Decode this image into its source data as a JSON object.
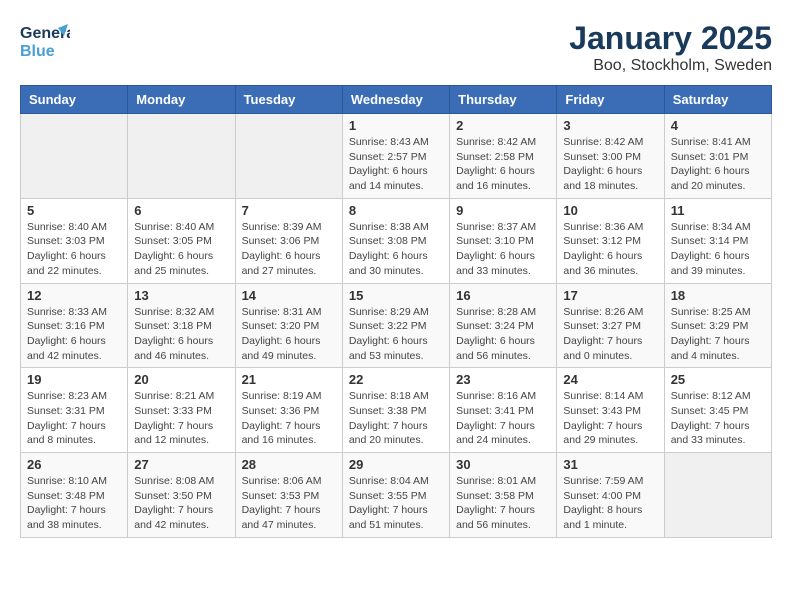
{
  "logo": {
    "line1": "General",
    "line2": "Blue"
  },
  "title": "January 2025",
  "subtitle": "Boo, Stockholm, Sweden",
  "days_of_week": [
    "Sunday",
    "Monday",
    "Tuesday",
    "Wednesday",
    "Thursday",
    "Friday",
    "Saturday"
  ],
  "weeks": [
    [
      {
        "day": "",
        "info": ""
      },
      {
        "day": "",
        "info": ""
      },
      {
        "day": "",
        "info": ""
      },
      {
        "day": "1",
        "info": "Sunrise: 8:43 AM\nSunset: 2:57 PM\nDaylight: 6 hours\nand 14 minutes."
      },
      {
        "day": "2",
        "info": "Sunrise: 8:42 AM\nSunset: 2:58 PM\nDaylight: 6 hours\nand 16 minutes."
      },
      {
        "day": "3",
        "info": "Sunrise: 8:42 AM\nSunset: 3:00 PM\nDaylight: 6 hours\nand 18 minutes."
      },
      {
        "day": "4",
        "info": "Sunrise: 8:41 AM\nSunset: 3:01 PM\nDaylight: 6 hours\nand 20 minutes."
      }
    ],
    [
      {
        "day": "5",
        "info": "Sunrise: 8:40 AM\nSunset: 3:03 PM\nDaylight: 6 hours\nand 22 minutes."
      },
      {
        "day": "6",
        "info": "Sunrise: 8:40 AM\nSunset: 3:05 PM\nDaylight: 6 hours\nand 25 minutes."
      },
      {
        "day": "7",
        "info": "Sunrise: 8:39 AM\nSunset: 3:06 PM\nDaylight: 6 hours\nand 27 minutes."
      },
      {
        "day": "8",
        "info": "Sunrise: 8:38 AM\nSunset: 3:08 PM\nDaylight: 6 hours\nand 30 minutes."
      },
      {
        "day": "9",
        "info": "Sunrise: 8:37 AM\nSunset: 3:10 PM\nDaylight: 6 hours\nand 33 minutes."
      },
      {
        "day": "10",
        "info": "Sunrise: 8:36 AM\nSunset: 3:12 PM\nDaylight: 6 hours\nand 36 minutes."
      },
      {
        "day": "11",
        "info": "Sunrise: 8:34 AM\nSunset: 3:14 PM\nDaylight: 6 hours\nand 39 minutes."
      }
    ],
    [
      {
        "day": "12",
        "info": "Sunrise: 8:33 AM\nSunset: 3:16 PM\nDaylight: 6 hours\nand 42 minutes."
      },
      {
        "day": "13",
        "info": "Sunrise: 8:32 AM\nSunset: 3:18 PM\nDaylight: 6 hours\nand 46 minutes."
      },
      {
        "day": "14",
        "info": "Sunrise: 8:31 AM\nSunset: 3:20 PM\nDaylight: 6 hours\nand 49 minutes."
      },
      {
        "day": "15",
        "info": "Sunrise: 8:29 AM\nSunset: 3:22 PM\nDaylight: 6 hours\nand 53 minutes."
      },
      {
        "day": "16",
        "info": "Sunrise: 8:28 AM\nSunset: 3:24 PM\nDaylight: 6 hours\nand 56 minutes."
      },
      {
        "day": "17",
        "info": "Sunrise: 8:26 AM\nSunset: 3:27 PM\nDaylight: 7 hours\nand 0 minutes."
      },
      {
        "day": "18",
        "info": "Sunrise: 8:25 AM\nSunset: 3:29 PM\nDaylight: 7 hours\nand 4 minutes."
      }
    ],
    [
      {
        "day": "19",
        "info": "Sunrise: 8:23 AM\nSunset: 3:31 PM\nDaylight: 7 hours\nand 8 minutes."
      },
      {
        "day": "20",
        "info": "Sunrise: 8:21 AM\nSunset: 3:33 PM\nDaylight: 7 hours\nand 12 minutes."
      },
      {
        "day": "21",
        "info": "Sunrise: 8:19 AM\nSunset: 3:36 PM\nDaylight: 7 hours\nand 16 minutes."
      },
      {
        "day": "22",
        "info": "Sunrise: 8:18 AM\nSunset: 3:38 PM\nDaylight: 7 hours\nand 20 minutes."
      },
      {
        "day": "23",
        "info": "Sunrise: 8:16 AM\nSunset: 3:41 PM\nDaylight: 7 hours\nand 24 minutes."
      },
      {
        "day": "24",
        "info": "Sunrise: 8:14 AM\nSunset: 3:43 PM\nDaylight: 7 hours\nand 29 minutes."
      },
      {
        "day": "25",
        "info": "Sunrise: 8:12 AM\nSunset: 3:45 PM\nDaylight: 7 hours\nand 33 minutes."
      }
    ],
    [
      {
        "day": "26",
        "info": "Sunrise: 8:10 AM\nSunset: 3:48 PM\nDaylight: 7 hours\nand 38 minutes."
      },
      {
        "day": "27",
        "info": "Sunrise: 8:08 AM\nSunset: 3:50 PM\nDaylight: 7 hours\nand 42 minutes."
      },
      {
        "day": "28",
        "info": "Sunrise: 8:06 AM\nSunset: 3:53 PM\nDaylight: 7 hours\nand 47 minutes."
      },
      {
        "day": "29",
        "info": "Sunrise: 8:04 AM\nSunset: 3:55 PM\nDaylight: 7 hours\nand 51 minutes."
      },
      {
        "day": "30",
        "info": "Sunrise: 8:01 AM\nSunset: 3:58 PM\nDaylight: 7 hours\nand 56 minutes."
      },
      {
        "day": "31",
        "info": "Sunrise: 7:59 AM\nSunset: 4:00 PM\nDaylight: 8 hours\nand 1 minute."
      },
      {
        "day": "",
        "info": ""
      }
    ]
  ]
}
